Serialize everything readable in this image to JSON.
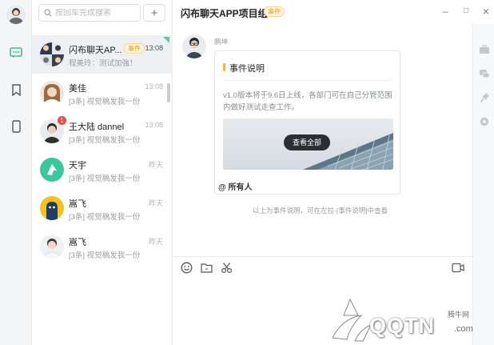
{
  "search": {
    "placeholder": "按回车完成搜索"
  },
  "add_label": "+",
  "chats": [
    {
      "name": "闪布聊天AP...",
      "tag": "事件",
      "preview": "程美玲：测试加強！",
      "time": "13:08",
      "unread": ""
    },
    {
      "name": "美佳",
      "tag": "",
      "preview": "[3条] 视觉稿发我一份",
      "time": "13:08",
      "unread": ""
    },
    {
      "name": "王大陆 dannel",
      "tag": "",
      "preview": "[3条] 视觉稿发我一份",
      "time": "13:08",
      "unread": "1"
    },
    {
      "name": "天宇",
      "tag": "",
      "preview": "[3条] 视觉稿发我一份",
      "time": "昨天",
      "unread": ""
    },
    {
      "name": "嵩飞",
      "tag": "",
      "preview": "[3条] 视觉稿发我一份",
      "time": "昨天",
      "unread": ""
    },
    {
      "name": "嵩飞",
      "tag": "",
      "preview": "[3条] 视觉稿发我一份",
      "time": "昨天",
      "unread": ""
    }
  ],
  "header": {
    "title": "闪布聊天APP项目组",
    "tag": "事件",
    "minimize": "–",
    "maximize": "□",
    "close": "×"
  },
  "message": {
    "sender": "鹏坤",
    "card_title": "事件说明",
    "card_body": "v1.0版本将于9.6日上线，各部门可在自己分管范围内做好测试走查工作。",
    "card_button": "查看全部",
    "mention": "@ 所有人"
  },
  "system_note": "以上为事件说明，可在左拉-[事件说明]中查看",
  "watermark": {
    "cn": "腾牛网",
    "en": "QQTN",
    "suffix": ".com"
  },
  "colors": {
    "accent": "#37c08a",
    "tag": "#e0a020",
    "badge": "#f04a4a"
  }
}
